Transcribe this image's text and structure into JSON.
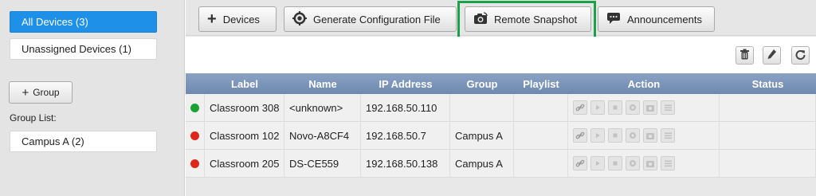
{
  "sidebar": {
    "items": [
      {
        "label": "All Devices (3)"
      },
      {
        "label": "Unassigned Devices (1)"
      }
    ],
    "group_button_label": "Group",
    "group_list_label": "Group List:",
    "groups": [
      {
        "label": "Campus A (2)"
      }
    ]
  },
  "toolbar": {
    "devices_label": "Devices",
    "generate_label": "Generate Configuration File",
    "snapshot_label": "Remote Snapshot",
    "announcements_label": "Announcements"
  },
  "table": {
    "columns": [
      "Label",
      "Name",
      "IP Address",
      "Group",
      "Playlist",
      "Action",
      "Status"
    ],
    "rows": [
      {
        "status_color": "#1aa32e",
        "label": "Classroom 308",
        "name": "<unknown>",
        "ip": "192.168.50.110",
        "group": "",
        "playlist": "",
        "status": ""
      },
      {
        "status_color": "#e0251b",
        "label": "Classroom 102",
        "name": "Novo-A8CF4",
        "ip": "192.168.50.7",
        "group": "Campus A",
        "playlist": "",
        "status": ""
      },
      {
        "status_color": "#e0251b",
        "label": "Classroom 205",
        "name": "DS-CE559",
        "ip": "192.168.50.138",
        "group": "Campus A",
        "playlist": "",
        "status": ""
      }
    ]
  },
  "icons": {
    "plus": "plus-icon",
    "gear": "gear-icon",
    "camera": "camera-icon",
    "chat": "chat-icon",
    "trash": "trash-icon",
    "pencil": "pencil-icon",
    "refresh": "refresh-icon"
  },
  "colors": {
    "selected": "#1e90e8",
    "online": "#1aa32e",
    "offline": "#e0251b",
    "highlight": "#1aa14a",
    "table_header": "#7a93b9"
  }
}
